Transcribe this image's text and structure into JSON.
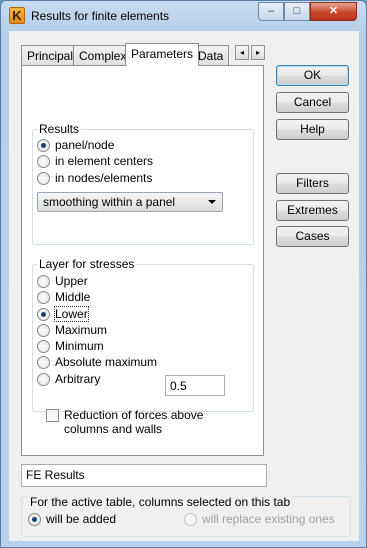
{
  "window": {
    "title": "Results for finite elements",
    "app_icon_letter": "K",
    "caption_buttons": {
      "minimize": "–",
      "maximize": "□",
      "close": "✕"
    }
  },
  "tabs": [
    {
      "label": "Principal"
    },
    {
      "label": "Complex"
    },
    {
      "label": "Parameters",
      "active": true
    },
    {
      "label": "Data"
    }
  ],
  "tab_scroll": {
    "left": "◂",
    "right": "▸"
  },
  "results": {
    "label": "Results",
    "options": [
      "panel/node",
      "in element centers",
      "in nodes/elements"
    ],
    "selected": "panel/node",
    "smoothing": "smoothing within a panel"
  },
  "layer": {
    "label": "Layer for stresses",
    "options": [
      "Upper",
      "Middle",
      "Lower",
      "Maximum",
      "Minimum",
      "Absolute maximum",
      "Arbitrary"
    ],
    "selected": "Lower",
    "arbitrary_value": "0.5"
  },
  "reduction": {
    "label": "Reduction of forces above columns and walls",
    "checked": false
  },
  "buttons": {
    "ok": "OK",
    "cancel": "Cancel",
    "help": "Help",
    "filters": "Filters",
    "extremes": "Extremes",
    "cases": "Cases"
  },
  "fe_results": "FE Results",
  "active_table": {
    "label": "For the active table, columns selected on this tab",
    "options": [
      "will be added",
      "will replace existing ones"
    ],
    "selected": "will be added"
  }
}
